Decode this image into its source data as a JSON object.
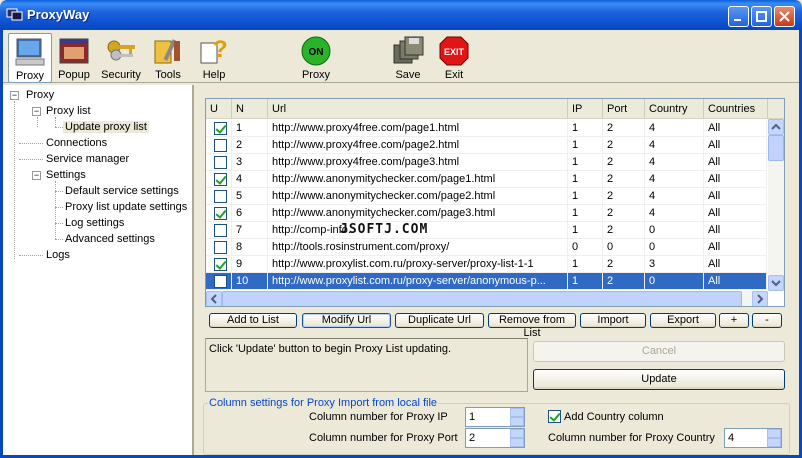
{
  "window": {
    "title": "ProxyWay"
  },
  "toolbar": {
    "items": [
      {
        "label": "Proxy",
        "icon": "monitor-icon"
      },
      {
        "label": "Popup",
        "icon": "popup-window-icon"
      },
      {
        "label": "Security",
        "icon": "keys-icon"
      },
      {
        "label": "Tools",
        "icon": "tools-icon"
      },
      {
        "label": "Help",
        "icon": "help-icon"
      },
      {
        "label": "Proxy",
        "icon": "on-switch-icon"
      },
      {
        "label": "Save",
        "icon": "floppy-disks-icon"
      },
      {
        "label": "Exit",
        "icon": "exit-sign-icon"
      }
    ],
    "on_badge": "ON",
    "exit_badge": "EXIT"
  },
  "tree": {
    "root": "Proxy",
    "proxy_list": "Proxy list",
    "update_proxy_list": "Update proxy list",
    "connections": "Connections",
    "service_manager": "Service manager",
    "settings": "Settings",
    "default_service_settings": "Default service settings",
    "proxy_list_update_settings": "Proxy list update settings",
    "log_settings": "Log settings",
    "advanced_settings": "Advanced settings",
    "logs": "Logs"
  },
  "grid": {
    "headers": [
      "U",
      "N",
      "Url",
      "IP",
      "Port",
      "Country",
      "Countries"
    ],
    "rows": [
      {
        "checked": true,
        "n": "1",
        "url": "http://www.proxy4free.com/page1.html",
        "ip": "1",
        "port": "2",
        "country": "4",
        "countries": "All"
      },
      {
        "checked": false,
        "n": "2",
        "url": "http://www.proxy4free.com/page2.html",
        "ip": "1",
        "port": "2",
        "country": "4",
        "countries": "All"
      },
      {
        "checked": false,
        "n": "3",
        "url": "http://www.proxy4free.com/page3.html",
        "ip": "1",
        "port": "2",
        "country": "4",
        "countries": "All"
      },
      {
        "checked": true,
        "n": "4",
        "url": "http://www.anonymitychecker.com/page1.html",
        "ip": "1",
        "port": "2",
        "country": "4",
        "countries": "All"
      },
      {
        "checked": false,
        "n": "5",
        "url": "http://www.anonymitychecker.com/page2.html",
        "ip": "1",
        "port": "2",
        "country": "4",
        "countries": "All"
      },
      {
        "checked": true,
        "n": "6",
        "url": "http://www.anonymitychecker.com/page3.html",
        "ip": "1",
        "port": "2",
        "country": "4",
        "countries": "All"
      },
      {
        "checked": false,
        "n": "7",
        "url": "http://comp-info.",
        "ip": "1",
        "port": "2",
        "country": "0",
        "countries": "All"
      },
      {
        "checked": false,
        "n": "8",
        "url": "http://tools.rosinstrument.com/proxy/",
        "ip": "0",
        "port": "0",
        "country": "0",
        "countries": "All"
      },
      {
        "checked": true,
        "n": "9",
        "url": "http://www.proxylist.com.ru/proxy-server/proxy-list-1-1",
        "ip": "1",
        "port": "2",
        "country": "3",
        "countries": "All"
      },
      {
        "checked": false,
        "n": "10",
        "url": "http://www.proxylist.com.ru/proxy-server/anonymous-p...",
        "ip": "1",
        "port": "2",
        "country": "0",
        "countries": "All",
        "selected": true
      }
    ]
  },
  "watermark": "JSOFTJ.COM",
  "buttons": {
    "add_to_list": "Add to List",
    "modify_url": "Modify Url",
    "duplicate_url": "Duplicate Url",
    "remove_from_list": "Remove from List",
    "import": "Import",
    "export": "Export",
    "plus": "+",
    "minus": "-",
    "cancel": "Cancel",
    "update": "Update"
  },
  "status_message": "Click 'Update' button to begin Proxy List updating.",
  "import_settings": {
    "title": "Column settings for Proxy Import from local file",
    "ip_label": "Column number for Proxy IP",
    "ip_value": "1",
    "port_label": "Column number for Proxy Port",
    "port_value": "2",
    "add_country_label": "Add Country column",
    "add_country_checked": true,
    "country_label": "Column number for Proxy Country",
    "country_value": "4"
  }
}
